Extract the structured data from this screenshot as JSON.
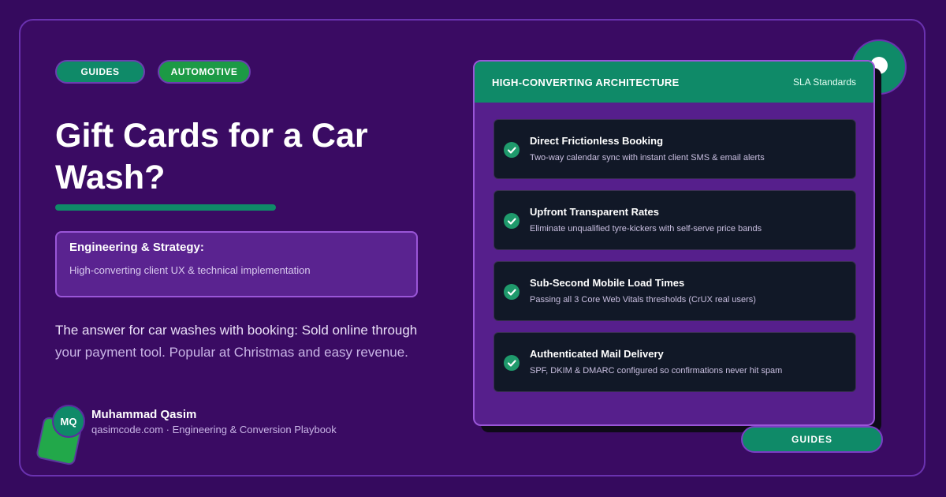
{
  "tags": [
    "GUIDES",
    "AUTOMOTIVE"
  ],
  "title": "Gift Cards for a Car Wash?",
  "strategy": {
    "title": "Engineering & Strategy:",
    "text": "High-converting client UX & technical implementation"
  },
  "description": {
    "part1": "The answer for car washes with booking: Sold online through",
    "part2": "your payment tool. Popular at Christmas and easy revenue."
  },
  "author": {
    "initials": "MQ",
    "name": "Muhammad Qasim",
    "subtitle": "qasimcode.com · Engineering & Conversion Playbook"
  },
  "panel": {
    "title": "HIGH-CONVERTING ARCHITECTURE",
    "subtitle": "SLA Standards",
    "features": [
      {
        "title": "Direct Frictionless Booking",
        "text": "Two-way calendar sync with instant client SMS & email alerts"
      },
      {
        "title": "Upfront Transparent Rates",
        "text": "Eliminate unqualified tyre-kickers with self-serve price bands"
      },
      {
        "title": "Sub-Second Mobile Load Times",
        "text": "Passing all 3 Core Web Vitals thresholds (CrUX real users)"
      },
      {
        "title": "Authenticated Mail Delivery",
        "text": "SPF, DKIM & DMARC configured so confirmations never hit spam"
      }
    ]
  },
  "bottom_tag": "GUIDES",
  "colors": {
    "background": "#350a5e",
    "accent_green": "#0f8a68",
    "panel_purple": "#561f8c",
    "card_dark": "#111827"
  },
  "icons": [
    "check-icon",
    "decorative-circle"
  ]
}
